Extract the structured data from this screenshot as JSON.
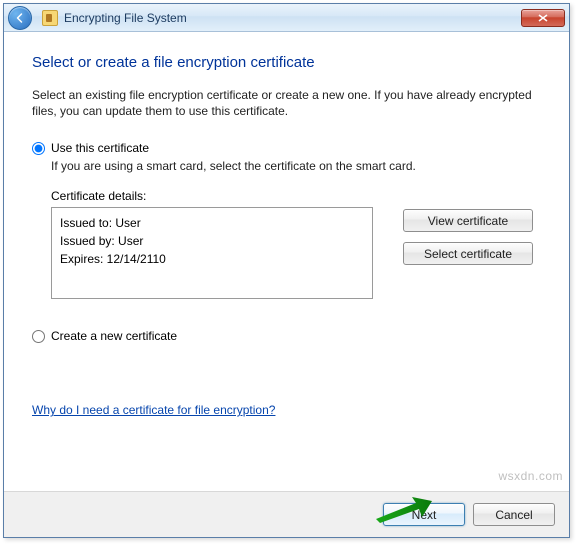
{
  "window": {
    "title": "Encrypting File System"
  },
  "heading": "Select or create a file encryption certificate",
  "description": "Select an existing file encryption certificate or create a new one. If you have already encrypted files, you can update them to use this certificate.",
  "options": {
    "use_cert_label": "Use this certificate",
    "use_cert_hint": "If you are using a smart card, select the certificate on the smart card.",
    "create_label": "Create a new certificate"
  },
  "details": {
    "label": "Certificate details:",
    "issued_to": "Issued to: User",
    "issued_by": "Issued by: User",
    "expires": "Expires: 12/14/2110"
  },
  "buttons": {
    "view": "View certificate",
    "select": "Select certificate",
    "next": "Next",
    "cancel": "Cancel"
  },
  "link": "Why do I need a certificate for file encryption?",
  "watermark": "wsxdn.com"
}
